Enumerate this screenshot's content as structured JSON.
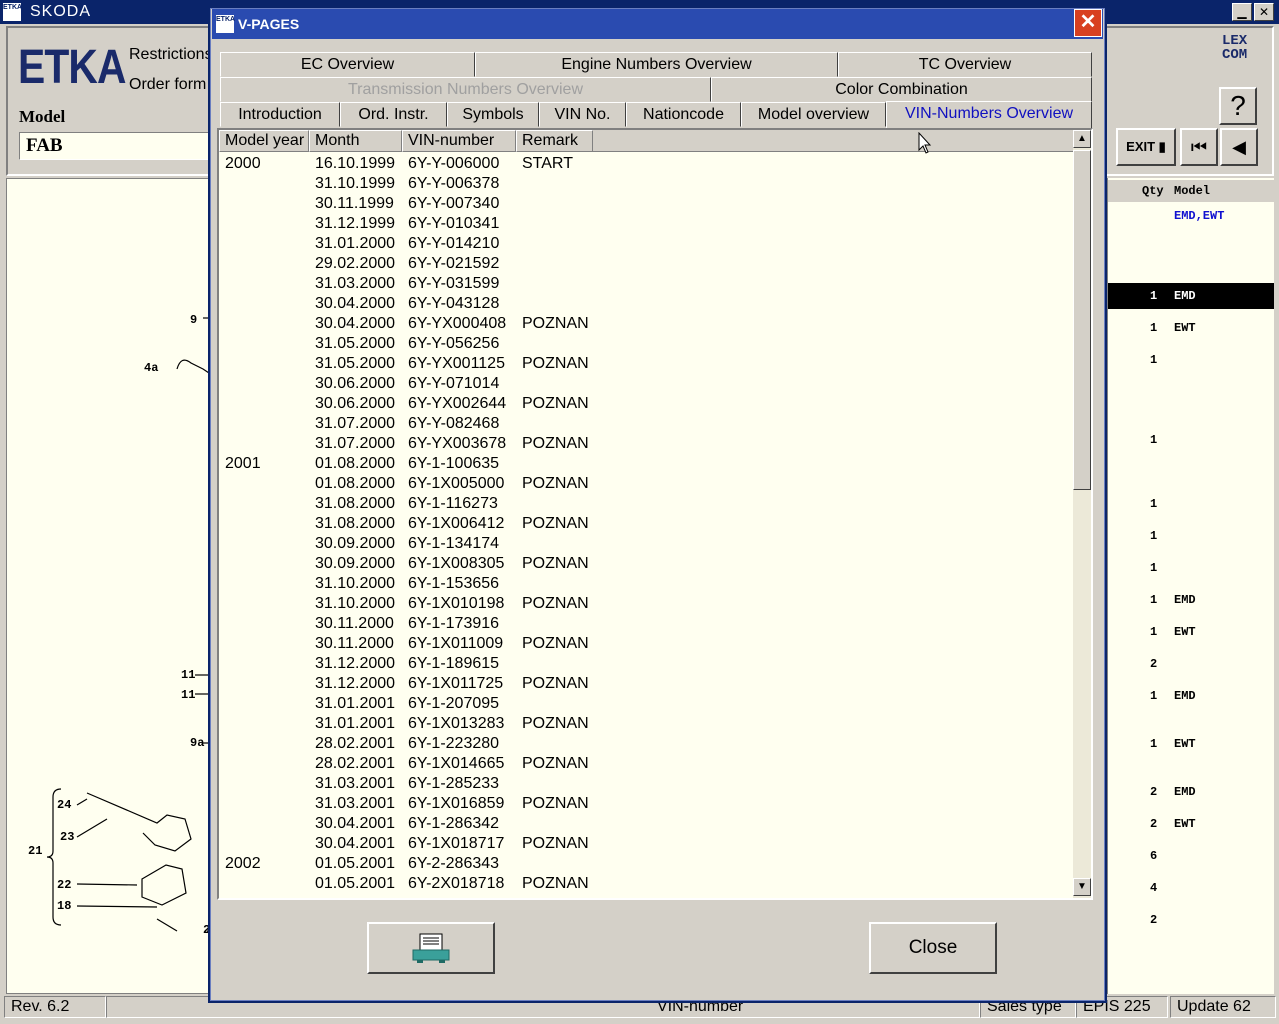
{
  "app": {
    "logo": "ETKA",
    "title": "SKODA",
    "header_logo": "ETKA",
    "restrictions": "Restrictions",
    "order_form": "Order form",
    "model_label": "Model",
    "model_value": "FAB",
    "lexcom": "LEX COM",
    "help": "?",
    "exit": "EXIT"
  },
  "right_panel": {
    "header_qty": "Qty",
    "header_model": "Model",
    "rows": [
      {
        "qty": "",
        "model": "EMD,EWT",
        "blue": true
      },
      {
        "qty": "1",
        "model": "EMD",
        "highlight": true
      },
      {
        "qty": "1",
        "model": "EWT"
      },
      {
        "qty": "1",
        "model": ""
      },
      {
        "qty": "1",
        "model": ""
      },
      {
        "qty": "1",
        "model": ""
      },
      {
        "qty": "1",
        "model": ""
      },
      {
        "qty": "1",
        "model": ""
      },
      {
        "qty": "1",
        "model": "EMD"
      },
      {
        "qty": "1",
        "model": "EWT"
      },
      {
        "qty": "2",
        "model": ""
      },
      {
        "qty": "1",
        "model": "EMD"
      },
      {
        "qty": "1",
        "model": "EWT"
      },
      {
        "qty": "2",
        "model": "EMD"
      },
      {
        "qty": "2",
        "model": "EWT"
      },
      {
        "qty": "6",
        "model": ""
      },
      {
        "qty": "4",
        "model": ""
      },
      {
        "qty": "2",
        "model": ""
      }
    ]
  },
  "drawing_callouts": [
    "9",
    "4a",
    "11",
    "11",
    "9a",
    "24",
    "23",
    "21",
    "22",
    "18",
    "2"
  ],
  "status": {
    "rev": "Rev. 6.2",
    "vin_number": "VIN-number",
    "sales_type": "Sales type",
    "epis": "EPIS 225",
    "update": "Update 62"
  },
  "dialog": {
    "logo": "ETKA",
    "title": "V-PAGES",
    "close_x": "✕",
    "tabs_row1": [
      "EC Overview",
      "Engine Numbers Overview",
      "TC Overview"
    ],
    "tabs_row2": [
      "Transmission Numbers Overview",
      "Color Combination"
    ],
    "tabs_row3": [
      "Introduction",
      "Ord. Instr.",
      "Symbols",
      "VIN No.",
      "Nationcode",
      "Model overview",
      "VIN-Numbers Overview"
    ],
    "columns": [
      "Model year",
      "Month",
      "VIN-number",
      "Remark"
    ],
    "rows": [
      [
        "2000",
        "16.10.1999",
        "6Y-Y-006000",
        "START"
      ],
      [
        "",
        "31.10.1999",
        "6Y-Y-006378",
        ""
      ],
      [
        "",
        "30.11.1999",
        "6Y-Y-007340",
        ""
      ],
      [
        "",
        "31.12.1999",
        "6Y-Y-010341",
        ""
      ],
      [
        "",
        "31.01.2000",
        "6Y-Y-014210",
        ""
      ],
      [
        "",
        "29.02.2000",
        "6Y-Y-021592",
        ""
      ],
      [
        "",
        "31.03.2000",
        "6Y-Y-031599",
        ""
      ],
      [
        "",
        "30.04.2000",
        "6Y-Y-043128",
        ""
      ],
      [
        "",
        "30.04.2000",
        "6Y-YX000408",
        "POZNAN"
      ],
      [
        "",
        "31.05.2000",
        "6Y-Y-056256",
        ""
      ],
      [
        "",
        "31.05.2000",
        "6Y-YX001125",
        "POZNAN"
      ],
      [
        "",
        "30.06.2000",
        "6Y-Y-071014",
        ""
      ],
      [
        "",
        "30.06.2000",
        "6Y-YX002644",
        "POZNAN"
      ],
      [
        "",
        "31.07.2000",
        "6Y-Y-082468",
        ""
      ],
      [
        "",
        "31.07.2000",
        "6Y-YX003678",
        "POZNAN"
      ],
      [
        "2001",
        "01.08.2000",
        "6Y-1-100635",
        ""
      ],
      [
        "",
        "01.08.2000",
        "6Y-1X005000",
        "POZNAN"
      ],
      [
        "",
        "31.08.2000",
        "6Y-1-116273",
        ""
      ],
      [
        "",
        "31.08.2000",
        "6Y-1X006412",
        "POZNAN"
      ],
      [
        "",
        "30.09.2000",
        "6Y-1-134174",
        ""
      ],
      [
        "",
        "30.09.2000",
        "6Y-1X008305",
        "POZNAN"
      ],
      [
        "",
        "31.10.2000",
        "6Y-1-153656",
        ""
      ],
      [
        "",
        "31.10.2000",
        "6Y-1X010198",
        "POZNAN"
      ],
      [
        "",
        "30.11.2000",
        "6Y-1-173916",
        ""
      ],
      [
        "",
        "30.11.2000",
        "6Y-1X011009",
        "POZNAN"
      ],
      [
        "",
        "31.12.2000",
        "6Y-1-189615",
        ""
      ],
      [
        "",
        "31.12.2000",
        "6Y-1X011725",
        "POZNAN"
      ],
      [
        "",
        "31.01.2001",
        "6Y-1-207095",
        ""
      ],
      [
        "",
        "31.01.2001",
        "6Y-1X013283",
        "POZNAN"
      ],
      [
        "",
        "28.02.2001",
        "6Y-1-223280",
        ""
      ],
      [
        "",
        "28.02.2001",
        "6Y-1X014665",
        "POZNAN"
      ],
      [
        "",
        "31.03.2001",
        "6Y-1-285233",
        ""
      ],
      [
        "",
        "31.03.2001",
        "6Y-1X016859",
        "POZNAN"
      ],
      [
        "",
        "30.04.2001",
        "6Y-1-286342",
        ""
      ],
      [
        "",
        "30.04.2001",
        "6Y-1X018717",
        "POZNAN"
      ],
      [
        "2002",
        "01.05.2001",
        "6Y-2-286343",
        ""
      ],
      [
        "",
        "01.05.2001",
        "6Y-2X018718",
        "POZNAN"
      ]
    ],
    "close_button": "Close",
    "print_icon": "printer-icon"
  }
}
